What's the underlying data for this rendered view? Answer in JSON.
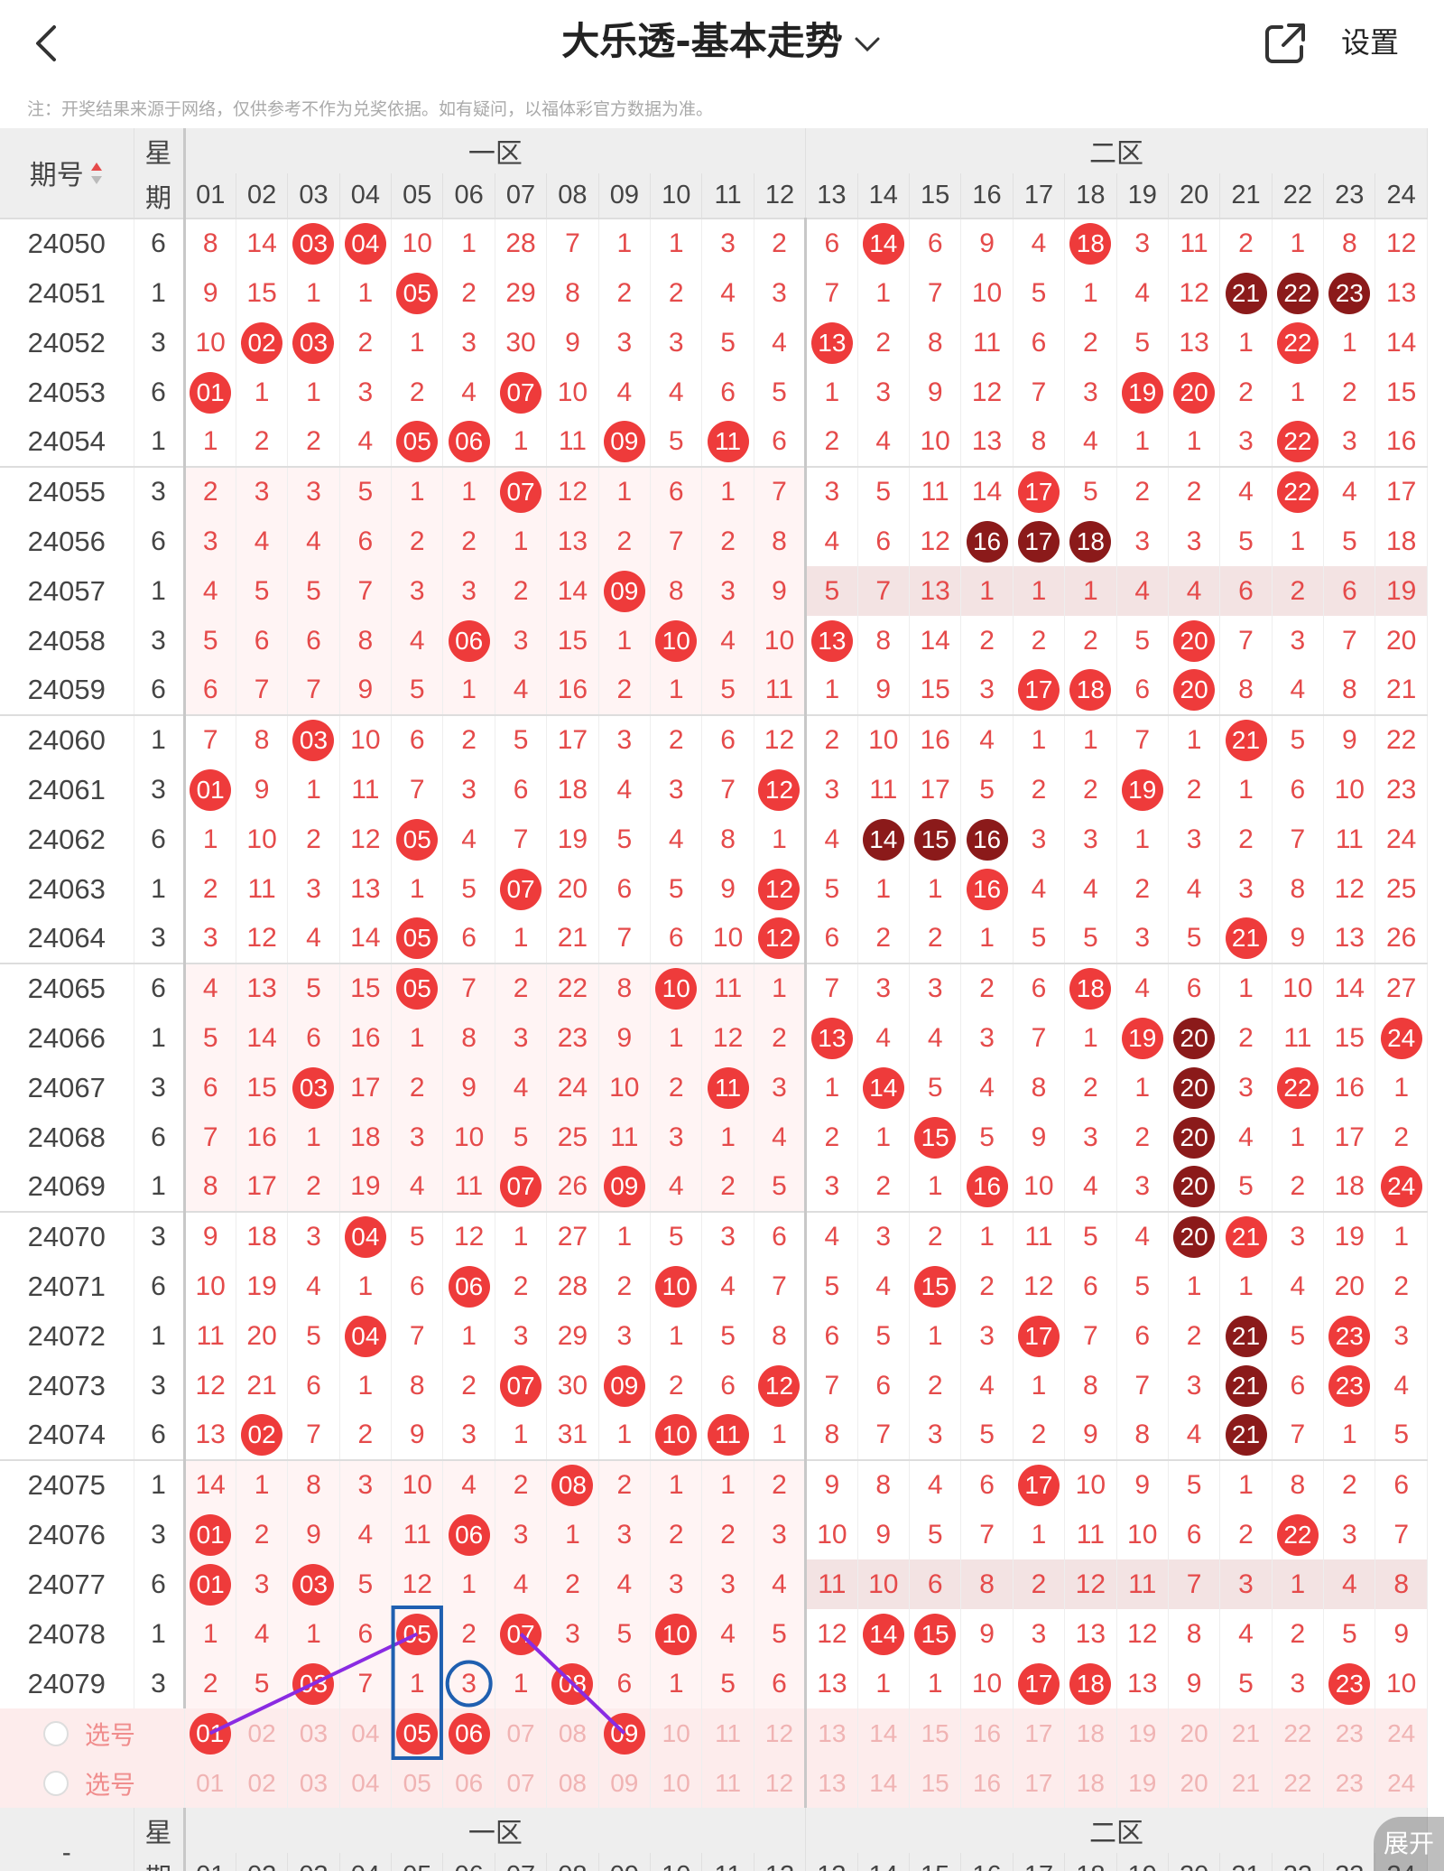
{
  "header": {
    "title": "大乐透-基本走势",
    "settings_label": "设置"
  },
  "notice": "注：开奖结果来源于网络，仅供参考不作为兑奖依据。如有疑问，以福体彩官方数据为准。",
  "table": {
    "period_header": "期号",
    "week_header_top": "星",
    "week_header_bottom": "期",
    "zone1_label": "一区",
    "zone2_label": "二区",
    "columns": [
      "01",
      "02",
      "03",
      "04",
      "05",
      "06",
      "07",
      "08",
      "09",
      "10",
      "11",
      "12",
      "13",
      "14",
      "15",
      "16",
      "17",
      "18",
      "19",
      "20",
      "21",
      "22",
      "23",
      "24"
    ],
    "rows": [
      {
        "period": "24050",
        "week": "6",
        "cells": [
          "8",
          "14",
          "03*",
          "04*",
          "10",
          "1",
          "28",
          "7",
          "1",
          "1",
          "3",
          "2",
          "6",
          "14*",
          "6",
          "9",
          "4",
          "18*",
          "3",
          "11",
          "2",
          "1",
          "8",
          "12"
        ]
      },
      {
        "period": "24051",
        "week": "1",
        "cells": [
          "9",
          "15",
          "1",
          "1",
          "05*",
          "2",
          "29",
          "8",
          "2",
          "2",
          "4",
          "3",
          "7",
          "1",
          "7",
          "10",
          "5",
          "1",
          "4",
          "12",
          "21d",
          "22d",
          "23d",
          "13"
        ]
      },
      {
        "period": "24052",
        "week": "3",
        "cells": [
          "10",
          "02*",
          "03*",
          "2",
          "1",
          "3",
          "30",
          "9",
          "3",
          "3",
          "5",
          "4",
          "13*",
          "2",
          "8",
          "11",
          "6",
          "2",
          "5",
          "13",
          "1",
          "22*",
          "1",
          "14"
        ]
      },
      {
        "period": "24053",
        "week": "6",
        "cells": [
          "01*",
          "1",
          "1",
          "3",
          "2",
          "4",
          "07*",
          "10",
          "4",
          "4",
          "6",
          "5",
          "1",
          "3",
          "9",
          "12",
          "7",
          "3",
          "19*",
          "20*",
          "2",
          "1",
          "2",
          "15"
        ]
      },
      {
        "period": "24054",
        "week": "1",
        "cells": [
          "1",
          "2",
          "2",
          "4",
          "05*",
          "06*",
          "1",
          "11",
          "09*",
          "5",
          "11*",
          "6",
          "2",
          "4",
          "10",
          "13",
          "8",
          "4",
          "1",
          "1",
          "3",
          "22*",
          "3",
          "16"
        ]
      },
      {
        "period": "24055",
        "week": "3",
        "cells": [
          "2",
          "3",
          "3",
          "5",
          "1",
          "1",
          "07*",
          "12",
          "1",
          "6",
          "1",
          "7",
          "3",
          "5",
          "11",
          "14",
          "17*",
          "5",
          "2",
          "2",
          "4",
          "22*",
          "4",
          "17"
        ]
      },
      {
        "period": "24056",
        "week": "6",
        "cells": [
          "3",
          "4",
          "4",
          "6",
          "2",
          "2",
          "1",
          "13",
          "2",
          "7",
          "2",
          "8",
          "4",
          "6",
          "12",
          "16d",
          "17d",
          "18d",
          "3",
          "3",
          "5",
          "1",
          "5",
          "18"
        ]
      },
      {
        "period": "24057",
        "week": "1",
        "cells": [
          "4",
          "5",
          "5",
          "7",
          "3",
          "3",
          "2",
          "14",
          "09*",
          "8",
          "3",
          "9",
          "5",
          "7",
          "13",
          "1",
          "1",
          "1",
          "4",
          "4",
          "6",
          "2",
          "6",
          "19"
        ]
      },
      {
        "period": "24058",
        "week": "3",
        "cells": [
          "5",
          "6",
          "6",
          "8",
          "4",
          "06*",
          "3",
          "15",
          "1",
          "10*",
          "4",
          "10",
          "13*",
          "8",
          "14",
          "2",
          "2",
          "2",
          "5",
          "20*",
          "7",
          "3",
          "7",
          "20"
        ]
      },
      {
        "period": "24059",
        "week": "6",
        "cells": [
          "6",
          "7",
          "7",
          "9",
          "5",
          "1",
          "4",
          "16",
          "2",
          "1",
          "5",
          "11",
          "1",
          "9",
          "15",
          "3",
          "17*",
          "18*",
          "6",
          "20*",
          "8",
          "4",
          "8",
          "21"
        ]
      },
      {
        "period": "24060",
        "week": "1",
        "cells": [
          "7",
          "8",
          "03*",
          "10",
          "6",
          "2",
          "5",
          "17",
          "3",
          "2",
          "6",
          "12",
          "2",
          "10",
          "16",
          "4",
          "1",
          "1",
          "7",
          "1",
          "21*",
          "5",
          "9",
          "22"
        ]
      },
      {
        "period": "24061",
        "week": "3",
        "cells": [
          "01*",
          "9",
          "1",
          "11",
          "7",
          "3",
          "6",
          "18",
          "4",
          "3",
          "7",
          "12*",
          "3",
          "11",
          "17",
          "5",
          "2",
          "2",
          "19*",
          "2",
          "1",
          "6",
          "10",
          "23"
        ]
      },
      {
        "period": "24062",
        "week": "6",
        "cells": [
          "1",
          "10",
          "2",
          "12",
          "05*",
          "4",
          "7",
          "19",
          "5",
          "4",
          "8",
          "1",
          "4",
          "14d",
          "15d",
          "16d",
          "3",
          "3",
          "1",
          "3",
          "2",
          "7",
          "11",
          "24"
        ]
      },
      {
        "period": "24063",
        "week": "1",
        "cells": [
          "2",
          "11",
          "3",
          "13",
          "1",
          "5",
          "07*",
          "20",
          "6",
          "5",
          "9",
          "12*",
          "5",
          "1",
          "1",
          "16*",
          "4",
          "4",
          "2",
          "4",
          "3",
          "8",
          "12",
          "25"
        ]
      },
      {
        "period": "24064",
        "week": "3",
        "cells": [
          "3",
          "12",
          "4",
          "14",
          "05*",
          "6",
          "1",
          "21",
          "7",
          "6",
          "10",
          "12*",
          "6",
          "2",
          "2",
          "1",
          "5",
          "5",
          "3",
          "5",
          "21*",
          "9",
          "13",
          "26"
        ]
      },
      {
        "period": "24065",
        "week": "6",
        "cells": [
          "4",
          "13",
          "5",
          "15",
          "05*",
          "7",
          "2",
          "22",
          "8",
          "10*",
          "11",
          "1",
          "7",
          "3",
          "3",
          "2",
          "6",
          "18*",
          "4",
          "6",
          "1",
          "10",
          "14",
          "27"
        ]
      },
      {
        "period": "24066",
        "week": "1",
        "cells": [
          "5",
          "14",
          "6",
          "16",
          "1",
          "8",
          "3",
          "23",
          "9",
          "1",
          "12",
          "2",
          "13*",
          "4",
          "4",
          "3",
          "7",
          "1",
          "19*",
          "20d",
          "2",
          "11",
          "15",
          "24*"
        ]
      },
      {
        "period": "24067",
        "week": "3",
        "cells": [
          "6",
          "15",
          "03*",
          "17",
          "2",
          "9",
          "4",
          "24",
          "10",
          "2",
          "11*",
          "3",
          "1",
          "14*",
          "5",
          "4",
          "8",
          "2",
          "1",
          "20d",
          "3",
          "22*",
          "16",
          "1"
        ]
      },
      {
        "period": "24068",
        "week": "6",
        "cells": [
          "7",
          "16",
          "1",
          "18",
          "3",
          "10",
          "5",
          "25",
          "11",
          "3",
          "1",
          "4",
          "2",
          "1",
          "15*",
          "5",
          "9",
          "3",
          "2",
          "20d",
          "4",
          "1",
          "17",
          "2"
        ]
      },
      {
        "period": "24069",
        "week": "1",
        "cells": [
          "8",
          "17",
          "2",
          "19",
          "4",
          "11",
          "07*",
          "26",
          "09*",
          "4",
          "2",
          "5",
          "3",
          "2",
          "1",
          "16*",
          "10",
          "4",
          "3",
          "20d",
          "5",
          "2",
          "18",
          "24*"
        ]
      },
      {
        "period": "24070",
        "week": "3",
        "cells": [
          "9",
          "18",
          "3",
          "04*",
          "5",
          "12",
          "1",
          "27",
          "1",
          "5",
          "3",
          "6",
          "4",
          "3",
          "2",
          "1",
          "11",
          "5",
          "4",
          "20d",
          "21*",
          "3",
          "19",
          "1"
        ]
      },
      {
        "period": "24071",
        "week": "6",
        "cells": [
          "10",
          "19",
          "4",
          "1",
          "6",
          "06*",
          "2",
          "28",
          "2",
          "10*",
          "4",
          "7",
          "5",
          "4",
          "15*",
          "2",
          "12",
          "6",
          "5",
          "1",
          "1",
          "4",
          "20",
          "2"
        ]
      },
      {
        "period": "24072",
        "week": "1",
        "cells": [
          "11",
          "20",
          "5",
          "04*",
          "7",
          "1",
          "3",
          "29",
          "3",
          "1",
          "5",
          "8",
          "6",
          "5",
          "1",
          "3",
          "17*",
          "7",
          "6",
          "2",
          "21d",
          "5",
          "23*",
          "3"
        ]
      },
      {
        "period": "24073",
        "week": "3",
        "cells": [
          "12",
          "21",
          "6",
          "1",
          "8",
          "2",
          "07*",
          "30",
          "09*",
          "2",
          "6",
          "12*",
          "7",
          "6",
          "2",
          "4",
          "1",
          "8",
          "7",
          "3",
          "21d",
          "6",
          "23*",
          "4"
        ]
      },
      {
        "period": "24074",
        "week": "6",
        "cells": [
          "13",
          "02*",
          "7",
          "2",
          "9",
          "3",
          "1",
          "31",
          "1",
          "10*",
          "11*",
          "1",
          "8",
          "7",
          "3",
          "5",
          "2",
          "9",
          "8",
          "4",
          "21d",
          "7",
          "1",
          "5"
        ]
      },
      {
        "period": "24075",
        "week": "1",
        "cells": [
          "14",
          "1",
          "8",
          "3",
          "10",
          "4",
          "2",
          "08*",
          "2",
          "1",
          "1",
          "2",
          "9",
          "8",
          "4",
          "6",
          "17*",
          "10",
          "9",
          "5",
          "1",
          "8",
          "2",
          "6"
        ]
      },
      {
        "period": "24076",
        "week": "3",
        "cells": [
          "01*",
          "2",
          "9",
          "4",
          "11",
          "06*",
          "3",
          "1",
          "3",
          "2",
          "2",
          "3",
          "10",
          "9",
          "5",
          "7",
          "1",
          "11",
          "10",
          "6",
          "2",
          "22*",
          "3",
          "7"
        ]
      },
      {
        "period": "24077",
        "week": "6",
        "cells": [
          "01*",
          "3",
          "03*",
          "5",
          "12",
          "1",
          "4",
          "2",
          "4",
          "3",
          "3",
          "4",
          "11",
          "10",
          "6",
          "8",
          "2",
          "12",
          "11",
          "7",
          "3",
          "1",
          "4",
          "8"
        ]
      },
      {
        "period": "24078",
        "week": "1",
        "cells": [
          "1",
          "4",
          "1",
          "6",
          "05*",
          "2",
          "07*",
          "3",
          "5",
          "10*",
          "4",
          "5",
          "12",
          "14*",
          "15*",
          "9",
          "3",
          "13",
          "12",
          "8",
          "4",
          "2",
          "5",
          "9"
        ]
      },
      {
        "period": "24079",
        "week": "3",
        "cells": [
          "2",
          "5",
          "03*",
          "7",
          "1",
          "3",
          "1",
          "08*",
          "6",
          "1",
          "5",
          "6",
          "13",
          "1",
          "1",
          "10",
          "17*",
          "18*",
          "13",
          "9",
          "5",
          "3",
          "23*",
          "10"
        ]
      }
    ],
    "pick_label": "选号",
    "pick_row1": [
      "01*",
      "02",
      "03",
      "04",
      "05*",
      "06*",
      "07",
      "08",
      "09*",
      "10",
      "11",
      "12",
      "13",
      "14",
      "15",
      "16",
      "17",
      "18",
      "19",
      "20",
      "21",
      "22",
      "23",
      "24"
    ],
    "pick_row2": [
      "01",
      "02",
      "03",
      "04",
      "05",
      "06",
      "07",
      "08",
      "09",
      "10",
      "11",
      "12",
      "13",
      "14",
      "15",
      "16",
      "17",
      "18",
      "19",
      "20",
      "21",
      "22",
      "23",
      "24"
    ],
    "footer_period": "-",
    "footer_week_top": "星",
    "footer_week_bottom": "期"
  },
  "expand_label": "展开",
  "colors": {
    "ball_red": "#ee3b3b",
    "ball_dark": "#8b1a1a",
    "cell_text": "#e54a4a",
    "annotation_line": "#8a2be2",
    "annotation_box": "#1f5fb0"
  },
  "icons": {
    "back": "chevron-left-icon",
    "title_dropdown": "chevron-down-icon",
    "share": "share-external-icon",
    "sort": "sort-arrows-icon",
    "radio": "radio-icon"
  }
}
